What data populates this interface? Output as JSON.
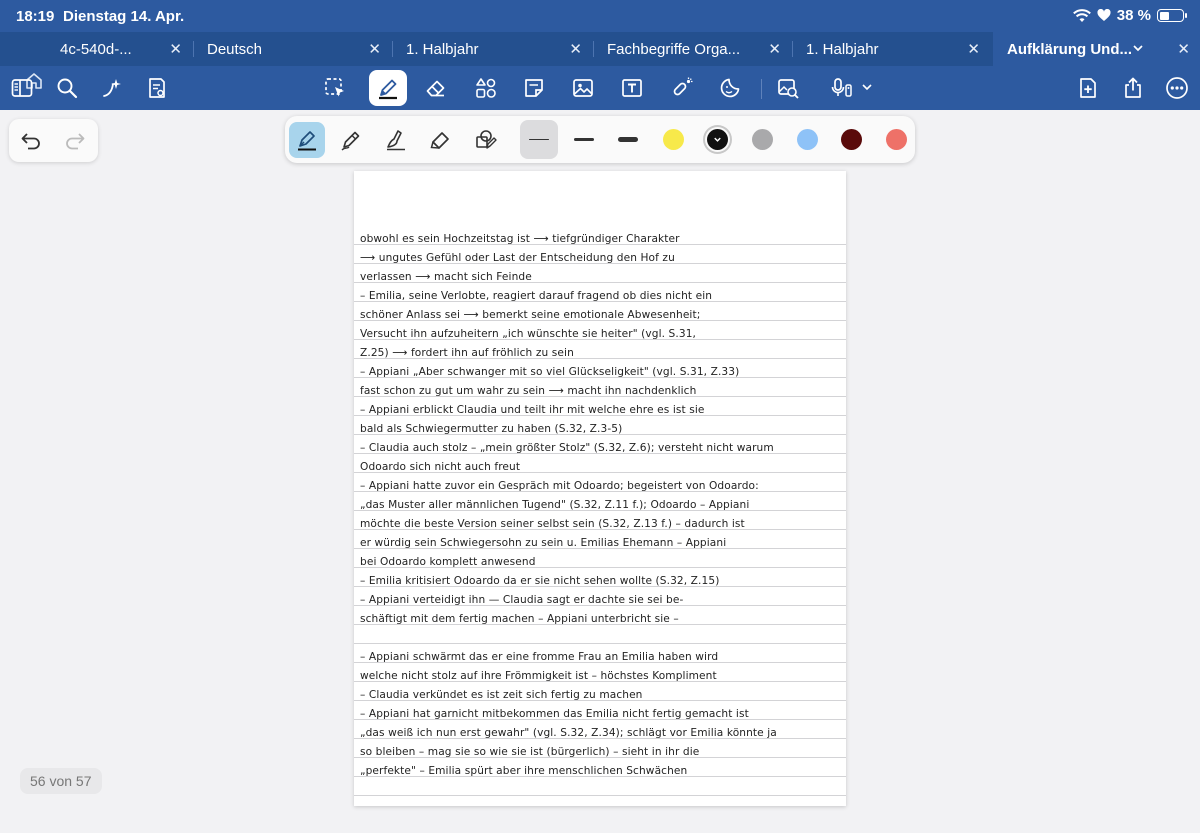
{
  "status_bar": {
    "time": "18:19",
    "date": "Dienstag 14. Apr.",
    "battery": "38 %",
    "battery_level": 0.38,
    "icons": [
      "wifi-icon",
      "heart-icon",
      "battery-icon"
    ]
  },
  "tabs": [
    {
      "label": "4c-540d-...",
      "active": false
    },
    {
      "label": "Deutsch",
      "active": false
    },
    {
      "label": "1. Halbjahr",
      "active": false
    },
    {
      "label": "Fachbegriffe Orga...",
      "active": false
    },
    {
      "label": "1. Halbjahr",
      "active": false
    },
    {
      "label": "Aufklärung Und...",
      "active": true
    }
  ],
  "toolbar_icons": [
    "sidebar-icon",
    "search-icon",
    "ai-sparkle-icon",
    "document-settings-icon",
    "lasso-icon",
    "pen-icon",
    "eraser-icon",
    "shapes-icon",
    "sticky-note-icon",
    "image-icon",
    "text-box-icon",
    "laser-pointer-icon",
    "sticker-icon",
    "web-image-icon",
    "microphone-icon",
    "add-page-icon",
    "share-icon",
    "more-icon"
  ],
  "palette": {
    "tools": [
      "fountain-pen-icon",
      "ball-pen-icon",
      "brush-pen-icon",
      "highlighter-icon",
      "shape-pen-icon"
    ],
    "widths": [
      "thin",
      "medium",
      "thick"
    ],
    "colors": [
      "#f7e94a",
      "#111111",
      "#a9a9ab",
      "#8ec2f7",
      "#5a0a0a",
      "#ee7168"
    ],
    "selected_color": "#111111"
  },
  "notes": [
    "obwohl es sein Hochzeitstag ist ⟶ tiefgründiger Charakter",
    "⟶ ungutes Gefühl oder Last der Entscheidung den Hof zu",
    "verlassen ⟶ macht sich Feinde",
    "– Emilia, seine Verlobte, reagiert darauf fragend ob dies nicht ein",
    "schöner Anlass sei ⟶ bemerkt seine emotionale Abwesenheit;",
    "Versucht ihn aufzuheitern „ich wünschte sie heiter\" (vgl. S.31,",
    "Z.25) ⟶ fordert ihn auf fröhlich zu sein",
    "– Appiani „Aber schwanger mit so viel Glückseligkeit\" (vgl. S.31, Z.33)",
    "fast schon zu gut um wahr zu sein ⟶ macht ihn nachdenklich",
    "– Appiani erblickt Claudia und teilt ihr mit welche ehre es ist sie",
    "bald als Schwiegermutter zu haben (S.32, Z.3-5)",
    "– Claudia auch stolz – „mein größter Stolz\" (S.32, Z.6); versteht nicht warum",
    "Odoardo sich nicht auch freut",
    "– Appiani hatte zuvor ein Gespräch mit Odoardo; begeistert von Odoardo:",
    "„das Muster aller männlichen Tugend\" (S.32, Z.11 f.); Odoardo – Appiani",
    "möchte die beste Version seiner selbst sein (S.32, Z.13 f.) – dadurch ist",
    "er würdig sein Schwiegersohn zu sein u. Emilias Ehemann – Appiani",
    "bei Odoardo komplett anwesend",
    "– Emilia kritisiert Odoardo da er sie nicht sehen wollte (S.32, Z.15)",
    "– Appiani verteidigt ihn — Claudia sagt er dachte sie sei be-",
    "schäftigt mit dem fertig machen – Appiani unterbricht sie –",
    "",
    "– Appiani schwärmt das er eine fromme Frau an Emilia haben wird",
    "welche nicht stolz auf ihre Frömmigkeit ist – höchstes Kompliment",
    "– Claudia verkündet es ist zeit sich fertig zu machen",
    "– Appiani hat garnicht mitbekommen das Emilia nicht fertig gemacht ist",
    "„das weiß ich nun erst gewahr\" (vgl. S.32, Z.34); schlägt vor Emilia könnte ja",
    "so bleiben – mag sie so wie sie ist (bürgerlich) – sieht in ihr die",
    "„perfekte\" – Emilia spürt aber ihre menschlichen Schwächen"
  ],
  "page_indicator": "56 von 57"
}
